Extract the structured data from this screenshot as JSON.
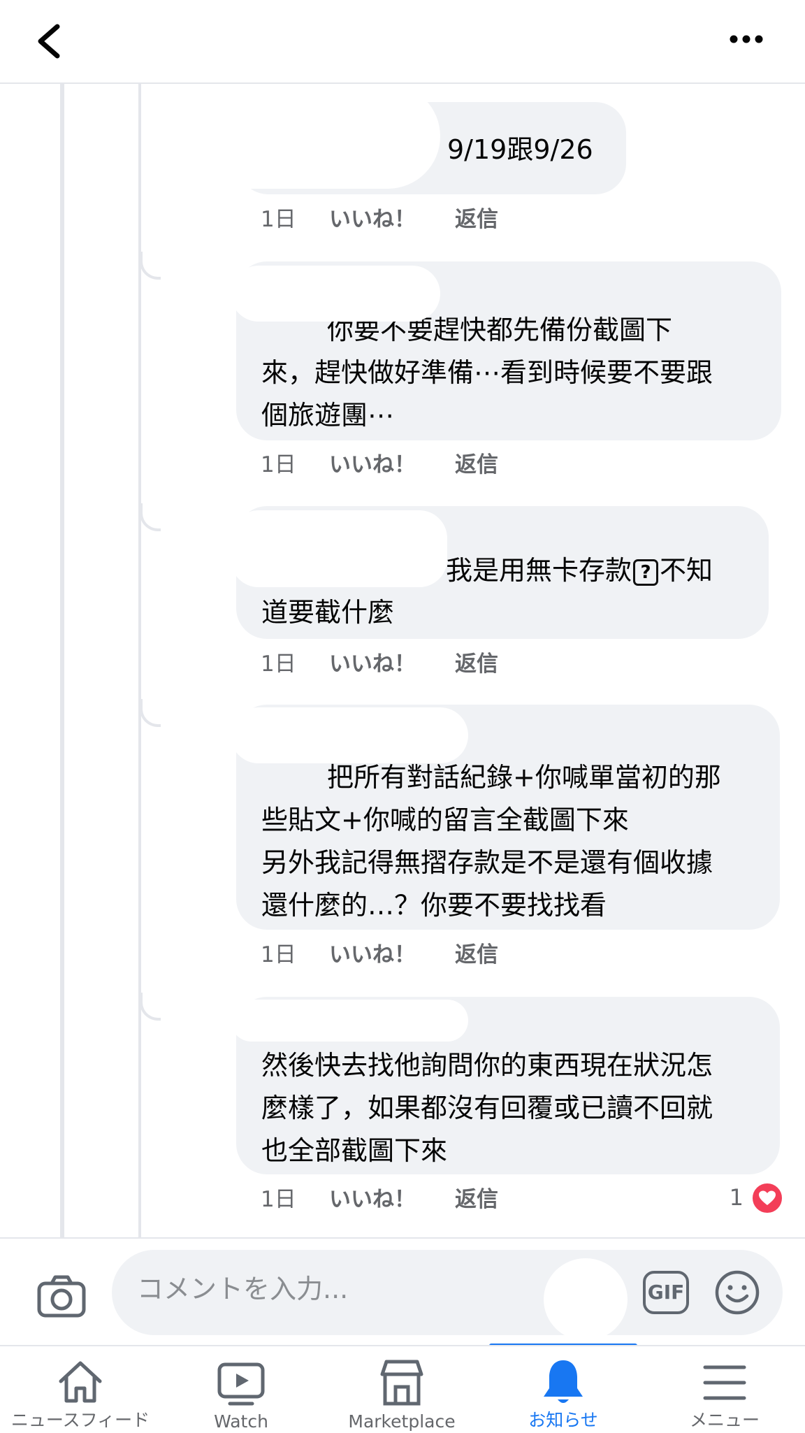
{
  "comments": [
    {
      "text": "9/19跟9/26",
      "time": "1日",
      "like": "いいね！",
      "reply": "返信"
    },
    {
      "lines": [
        "你要不要趕快都先備份截圖下",
        "來，趕快做好準備⋯看到時候要不要跟",
        "個旅遊團⋯"
      ],
      "time": "1日",
      "like": "いいね！",
      "reply": "返信"
    },
    {
      "line1_a": "我是用無卡存款",
      "line1_icon": "?",
      "line1_b": "不知",
      "line2": "道要截什麼",
      "time": "1日",
      "like": "いいね！",
      "reply": "返信"
    },
    {
      "lines": [
        "把所有對話紀錄+你喊單當初的那",
        "些貼文+你喊的留言全截圖下來",
        "另外我記得無摺存款是不是還有個收據",
        "還什麼的…？你要不要找找看"
      ],
      "time": "1日",
      "like": "いいね！",
      "reply": "返信"
    },
    {
      "lines": [
        "然後快去找他詢問你的東西現在狀況怎",
        "麼樣了，如果都沒有回覆或已讀不回就",
        "也全部截圖下來"
      ],
      "time": "1日",
      "like": "いいね！",
      "reply": "返信",
      "reaction_count": "1"
    }
  ],
  "composer": {
    "placeholder": "コメントを入力...",
    "gif_label": "GIF"
  },
  "nav": [
    {
      "label": "ニュースフィード",
      "icon": "home-icon"
    },
    {
      "label": "Watch",
      "icon": "video-icon"
    },
    {
      "label": "Marketplace",
      "icon": "shop-icon"
    },
    {
      "label": "お知らせ",
      "icon": "bell-icon",
      "active": true
    },
    {
      "label": "メニュー",
      "icon": "menu-icon"
    }
  ],
  "colors": {
    "accent": "#1877f2",
    "bubble": "#f0f2f5",
    "meta": "#65676b",
    "heart": "#f33e58"
  }
}
